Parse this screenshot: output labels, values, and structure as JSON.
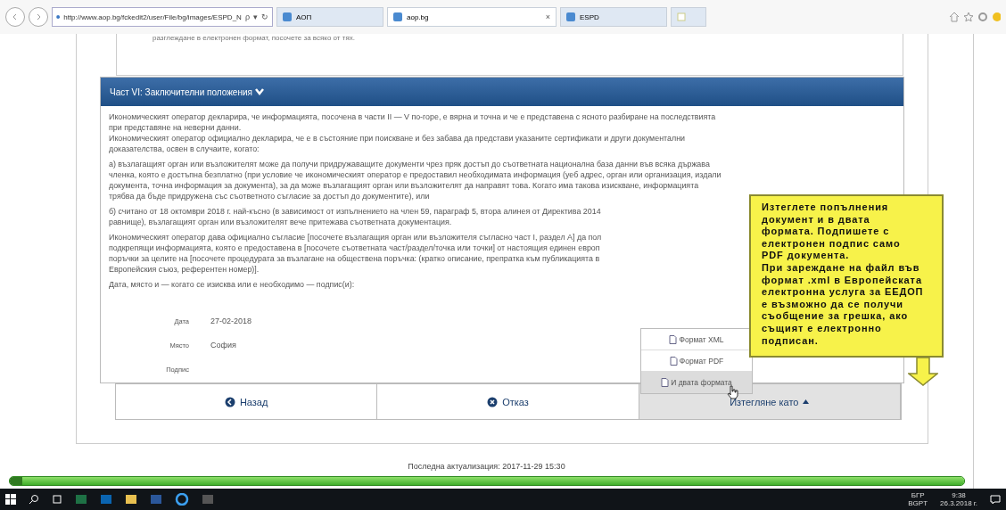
{
  "browser": {
    "address": "http://www.aop.bg/fckedit2/user/File/bg/images/ESPD_N",
    "search_icon": "ρ",
    "dropdown": "▾",
    "refresh": "↻",
    "tabs": [
      {
        "label": "АОП",
        "selected": false
      },
      {
        "label": "aop.bg",
        "selected": true,
        "close": "×"
      },
      {
        "label": "ESPD",
        "selected": false
      }
    ]
  },
  "top_fragment": "разглеждане в електронен формат, посочете за всяко от тях.",
  "section": {
    "title": "Част VI: Заключителни положения",
    "expanded": true,
    "paragraphs": [
      {
        "lines": [
          "Икономическият оператор декларира, че информацията, посочена в части II — V по-горе, е вярна и точна и че е представена с ясното разбиране на последствията",
          "при представяне на неверни данни.",
          "Икономическият оператор официално декларира, че е в състояние при поискване и без забава да представи указаните сертификати и други документални",
          "доказателства, освен в случаите, когато:"
        ]
      },
      {
        "lines": [
          "а) възлагащият орган или възложителят може да получи придружаващите документи чрез пряк достъп до съответната национална база данни във всяка държава",
          "членка, която е достъпна безплатно (при условие че икономическият оператор е предоставил необходимата информация (уеб адрес, орган или организация, издали",
          "документа, точна информация за документа), за да може възлагащият орган или възложителят да направят това. Когато има такова изискване, информацията",
          "трябва да бъде придружена със съответното съгласие за достъп до документите), или"
        ]
      },
      {
        "lines": [
          "б) считано от 18 октомври 2018 г. най-късно (в зависимост от изпълнението на член 59, параграф 5, втора алинея от Директива 2014",
          "равнище), възлагащият орган или възложителят вече притежава съответната документация."
        ]
      },
      {
        "lines": [
          "Икономическият оператор дава официално съгласие [посочете възлагащия орган или възложителя съгласно част I, раздел А] да пол",
          "подкрепящи информацията, която е предоставена в [посочете съответната част/раздел/точка или точки] от настоящия единен европ",
          "поръчки за целите на [посочете процедурата за възлагане на обществена поръчка: (кратко описание, препратка към публикацията в",
          "Европейския съюз, референтен номер)]."
        ]
      },
      {
        "lines": [
          "Дата, място и — когато се изисква или е необходимо — подпис(и):"
        ]
      }
    ],
    "fields": [
      {
        "label": "Дата",
        "value": "27-02-2018"
      },
      {
        "label": "Място",
        "value": "София"
      },
      {
        "label": "Подпис"
      }
    ]
  },
  "buttons": [
    {
      "label": "Назад",
      "kind": "back",
      "selected": false
    },
    {
      "label": "Отказ",
      "kind": "cancel",
      "selected": false
    },
    {
      "label": "Изтегляне като",
      "kind": "menu",
      "selected": true
    }
  ],
  "menu": [
    {
      "label": "Формат XML",
      "selected": false
    },
    {
      "label": "Формат PDF",
      "selected": false
    },
    {
      "label": "И двата формата",
      "selected": true
    }
  ],
  "callout": [
    "Изтеглете попълнения документ и в двата формата. Подпишете с електронен подпис само PDF документа.",
    "При зареждане на  файл във формат .xml в Европейската електронна услуга за ЕЕДОП е възможно да се получи съобщение за грешка, ако същият е електронно подписан."
  ],
  "footer": "Последна актуализация: 2017-11-29 15:30",
  "taskbar": {
    "language": "БГР",
    "layout": "BGPT",
    "time": "9:38",
    "date": "26.3.2018 г."
  }
}
